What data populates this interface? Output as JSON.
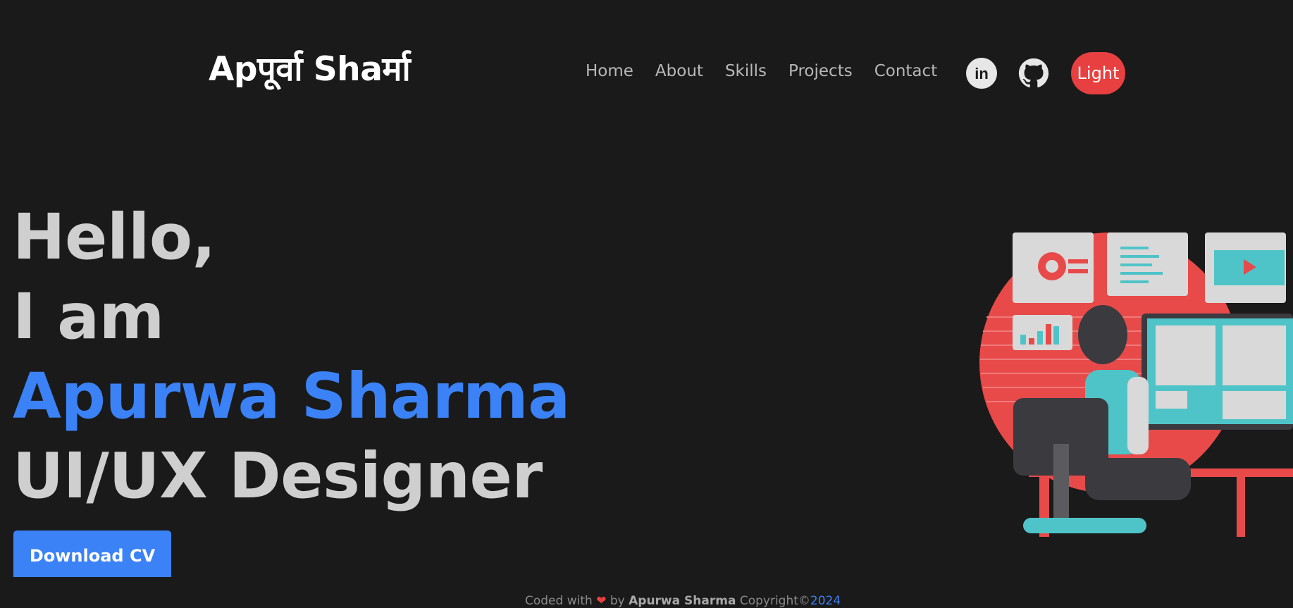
{
  "header": {
    "logo": "Apपूर्वा Shaर्मा",
    "nav": [
      "Home",
      "About",
      "Skills",
      "Projects",
      "Contact"
    ],
    "theme_button": "Light"
  },
  "social": [
    "linkedin-icon",
    "github-icon"
  ],
  "hero": {
    "line1": "Hello,",
    "line2": "I am",
    "name": "Apurwa Sharma",
    "role": "UI/UX Designer",
    "cta": "Download CV"
  },
  "footer": {
    "prefix": "Coded with",
    "by": "by",
    "author": "Apurwa Sharma",
    "copyright": "Copyright©",
    "year": "2024"
  },
  "colors": {
    "background": "#1a1a1a",
    "accent_blue": "#3b82f6",
    "accent_red": "#e84040",
    "text": "#cfcfcf"
  }
}
